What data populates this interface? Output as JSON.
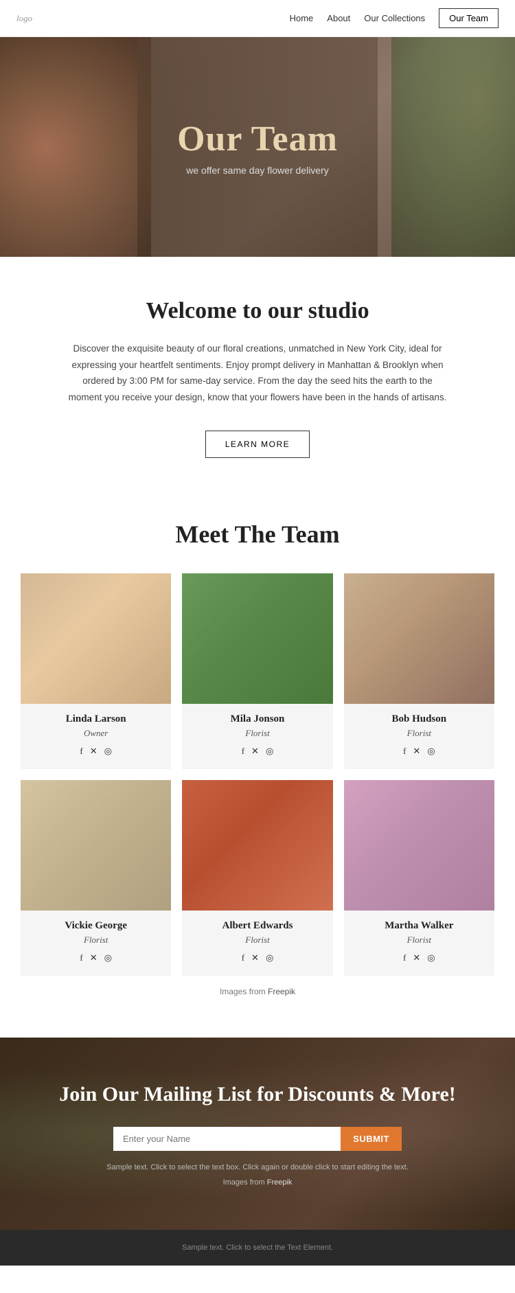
{
  "nav": {
    "logo": "logo",
    "links": [
      {
        "label": "Home",
        "name": "nav-home"
      },
      {
        "label": "About",
        "name": "nav-about"
      },
      {
        "label": "Our Collections",
        "name": "nav-collections"
      },
      {
        "label": "Our Team",
        "name": "nav-our-team"
      }
    ]
  },
  "hero": {
    "title": "Our Team",
    "subtitle": "we offer same day flower delivery"
  },
  "welcome": {
    "title": "Welcome to our studio",
    "body": "Discover the exquisite beauty of our floral creations, unmatched in New York City, ideal for expressing your heartfelt sentiments. Enjoy prompt delivery in Manhattan & Brooklyn when ordered by 3:00 PM for same-day service.  From the day the seed hits the earth to the moment you receive your design, know that your flowers have been in the hands of artisans.",
    "button": "LEARN MORE"
  },
  "team": {
    "section_title": "Meet The Team",
    "members": [
      {
        "name": "Linda Larson",
        "role": "Owner",
        "img_class": "img-linda",
        "social": [
          "f",
          "𝕏",
          "◎"
        ]
      },
      {
        "name": "Mila Jonson",
        "role": "Florist",
        "img_class": "img-mila",
        "social": [
          "f",
          "𝕏",
          "◎"
        ]
      },
      {
        "name": "Bob Hudson",
        "role": "Florist",
        "img_class": "img-bob",
        "social": [
          "f",
          "𝕏",
          "◎"
        ]
      },
      {
        "name": "Vickie George",
        "role": "Florist",
        "img_class": "img-vickie",
        "social": [
          "f",
          "𝕏",
          "◎"
        ]
      },
      {
        "name": "Albert Edwards",
        "role": "Florist",
        "img_class": "img-albert",
        "social": [
          "f",
          "𝕏",
          "◎"
        ]
      },
      {
        "name": "Martha Walker",
        "role": "Florist",
        "img_class": "img-martha",
        "social": [
          "f",
          "𝕏",
          "◎"
        ]
      }
    ],
    "images_credit_pre": "Images from ",
    "images_credit_link": "Freepik"
  },
  "mailing": {
    "title": "Join Our Mailing List for Discounts & More!",
    "input_placeholder": "Enter your Name",
    "submit_label": "SUBMIT",
    "sample_text": "Sample text. Click to select the text box. Click again or double click to start editing the text.",
    "credit_pre": "Images from ",
    "credit_link": "Freepik"
  },
  "footer": {
    "text": "Sample text. Click to select the Text Element."
  }
}
